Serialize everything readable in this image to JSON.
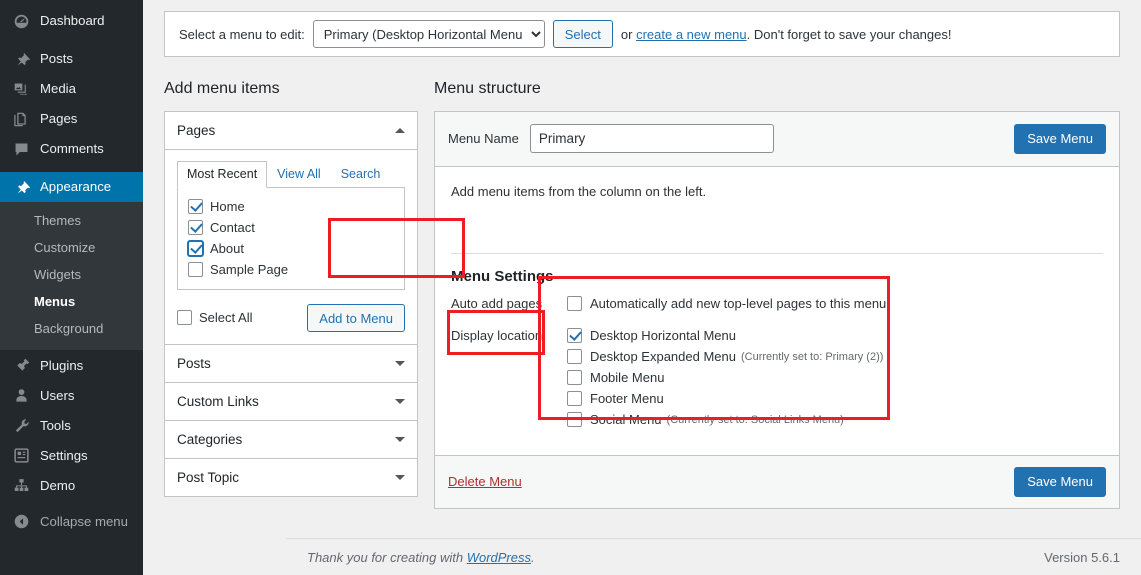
{
  "sidebar": {
    "items": [
      {
        "label": "Dashboard",
        "icon": "dashboard-icon"
      },
      {
        "label": "Posts",
        "icon": "pin-icon"
      },
      {
        "label": "Media",
        "icon": "media-icon"
      },
      {
        "label": "Pages",
        "icon": "pages-icon"
      },
      {
        "label": "Comments",
        "icon": "comments-icon"
      },
      {
        "label": "Appearance",
        "icon": "appearance-brush-icon"
      },
      {
        "label": "Plugins",
        "icon": "plugins-icon"
      },
      {
        "label": "Users",
        "icon": "users-icon"
      },
      {
        "label": "Tools",
        "icon": "tools-wrench-icon"
      },
      {
        "label": "Settings",
        "icon": "settings-icon"
      },
      {
        "label": "Demo",
        "icon": "demo-sitemap-icon"
      },
      {
        "label": "Collapse menu",
        "icon": "collapse-arrow-icon"
      }
    ],
    "appearance_submenu": [
      {
        "label": "Themes"
      },
      {
        "label": "Customize"
      },
      {
        "label": "Widgets"
      },
      {
        "label": "Menus"
      },
      {
        "label": "Background"
      }
    ],
    "active_item": "Appearance",
    "active_subitem": "Menus",
    "accent_color": "#0073aa",
    "background_color": "#23282d",
    "submenu_background": "#32373c"
  },
  "menu_selector": {
    "label": "Select a menu to edit:",
    "selected": "Primary (Desktop Horizontal Menu)",
    "options": [
      "Primary (Desktop Horizontal Menu)"
    ],
    "select_button": "Select",
    "or_text": "or",
    "create_link": "create a new menu",
    "tail_text": ". Don't forget to save your changes!"
  },
  "add_menu_items": {
    "heading": "Add menu items",
    "sections": [
      {
        "title": "Pages",
        "expanded": true,
        "tabs": [
          {
            "label": "Most Recent",
            "active": true
          },
          {
            "label": "View All",
            "active": false
          },
          {
            "label": "Search",
            "active": false
          }
        ],
        "items": [
          {
            "label": "Home",
            "checked": true,
            "focused": false
          },
          {
            "label": "Contact",
            "checked": true,
            "focused": false
          },
          {
            "label": "About",
            "checked": true,
            "focused": true
          },
          {
            "label": "Sample Page",
            "checked": false,
            "focused": false
          }
        ],
        "select_all_label": "Select All",
        "select_all_checked": false,
        "add_button": "Add to Menu"
      },
      {
        "title": "Posts",
        "expanded": false
      },
      {
        "title": "Custom Links",
        "expanded": false
      },
      {
        "title": "Categories",
        "expanded": false
      },
      {
        "title": "Post Topic",
        "expanded": false
      }
    ]
  },
  "menu_structure": {
    "heading": "Menu structure",
    "menu_name_label": "Menu Name",
    "menu_name_value": "Primary",
    "save_button_top": "Save Menu",
    "hint": "Add menu items from the column on the left.",
    "settings": {
      "heading": "Menu Settings",
      "auto_add_label": "Auto add pages",
      "auto_add_option": {
        "label": "Automatically add new top-level pages to this menu",
        "checked": false
      },
      "display_location_label": "Display location",
      "locations": [
        {
          "label": "Desktop Horizontal Menu",
          "note": "",
          "checked": true
        },
        {
          "label": "Desktop Expanded Menu",
          "note": "(Currently set to: Primary (2))",
          "checked": false
        },
        {
          "label": "Mobile Menu",
          "note": "",
          "checked": false
        },
        {
          "label": "Footer Menu",
          "note": "",
          "checked": false
        },
        {
          "label": "Social Menu",
          "note": "(Currently set to: Social Links Menu)",
          "checked": false
        }
      ]
    },
    "delete_link": "Delete Menu",
    "save_button_bottom": "Save Menu"
  },
  "footer": {
    "thanks_prefix": "Thank you for creating with ",
    "wordpress_link": "WordPress",
    "thanks_suffix": ".",
    "version": "Version 5.6.1"
  },
  "annotations": {
    "highlight_color": "#ee1c25",
    "boxes": [
      {
        "name": "pages-checkbox-highlight"
      },
      {
        "name": "add-to-menu-highlight"
      },
      {
        "name": "menu-settings-highlight"
      }
    ]
  }
}
